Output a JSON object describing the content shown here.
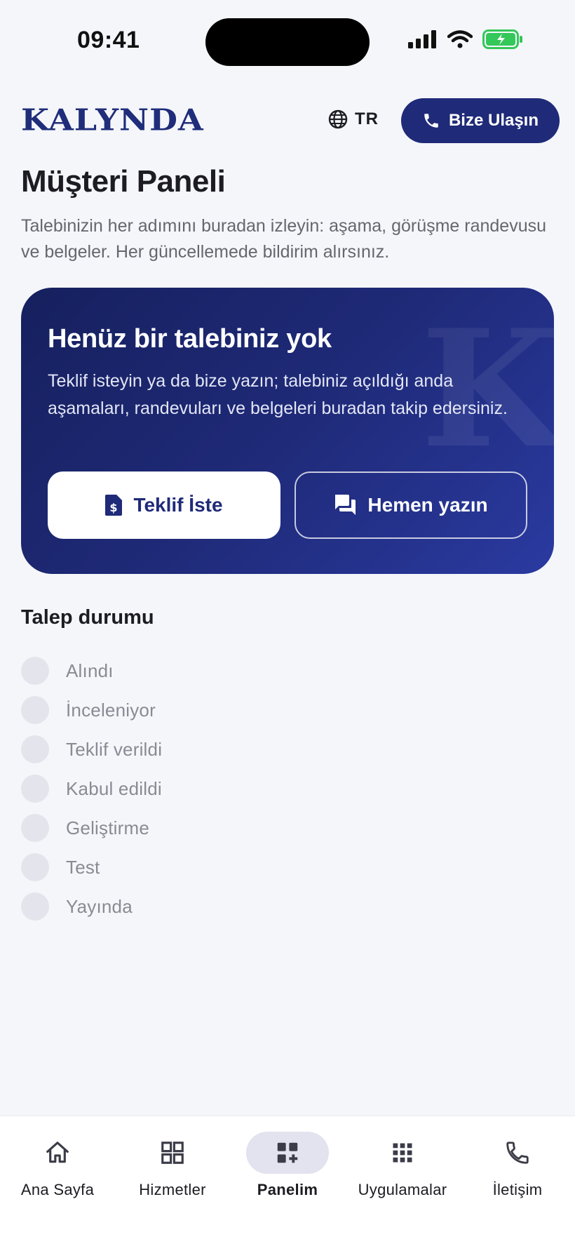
{
  "status_bar": {
    "time": "09:41"
  },
  "header": {
    "logo": "KALYNDA",
    "language": "TR",
    "contact_button": "Bize Ulaşın"
  },
  "page": {
    "title": "Müşteri Paneli",
    "description": "Talebinizin her adımını buradan izleyin: aşama, görüşme randevusu ve belgeler. Her güncellemede bildirim alırsınız."
  },
  "hero": {
    "watermark": "K",
    "title": "Henüz bir talebiniz yok",
    "text": "Teklif isteyin ya da bize yazın; talebiniz açıldığı anda aşamaları, randevuları ve belgeleri buradan takip edersiniz.",
    "primary_button": "Teklif İste",
    "secondary_button": "Hemen yazın"
  },
  "status_section": {
    "title": "Talep durumu",
    "steps": [
      "Alındı",
      "İnceleniyor",
      "Teklif verildi",
      "Kabul edildi",
      "Geliştirme",
      "Test",
      "Yayında"
    ]
  },
  "bottom_nav": {
    "items": [
      {
        "label": "Ana Sayfa",
        "icon": "home-icon"
      },
      {
        "label": "Hizmetler",
        "icon": "grid-icon"
      },
      {
        "label": "Panelim",
        "icon": "dashboard-add-icon",
        "active": true
      },
      {
        "label": "Uygulamalar",
        "icon": "apps-icon"
      },
      {
        "label": "İletişim",
        "icon": "phone-icon"
      }
    ]
  },
  "colors": {
    "brand": "#1f2a78",
    "background": "#f5f6fa",
    "battery": "#34c759"
  }
}
